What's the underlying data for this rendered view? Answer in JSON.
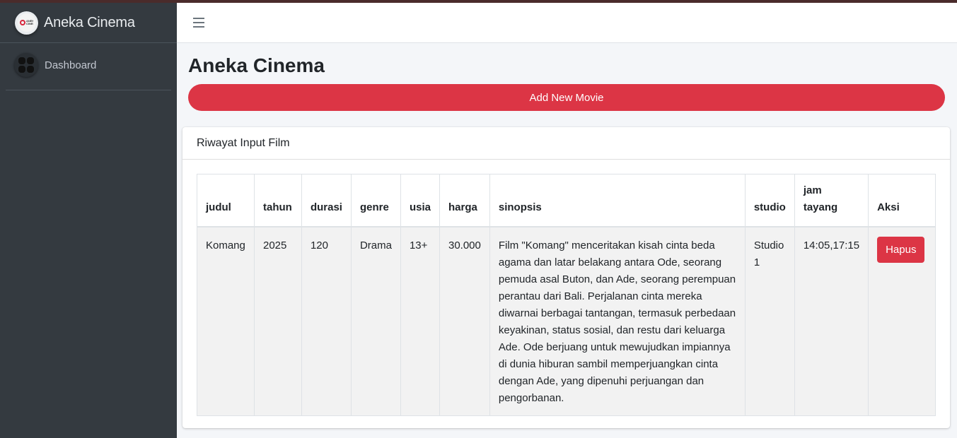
{
  "sidebar": {
    "brand_name": "Aneka Cinema",
    "logo_text": "ANEKA CINEMA",
    "items": [
      {
        "label": "Dashboard",
        "icon": "dashboard-grid-icon"
      }
    ]
  },
  "navbar": {
    "menu_icon": "hamburger-icon"
  },
  "page": {
    "title": "Aneka Cinema",
    "add_button": "Add New Movie"
  },
  "card": {
    "header": "Riwayat Input Film",
    "columns": [
      "judul",
      "tahun",
      "durasi",
      "genre",
      "usia",
      "harga",
      "sinopsis",
      "studio",
      "jam tayang",
      "Aksi"
    ],
    "rows": [
      {
        "judul": "Komang",
        "tahun": "2025",
        "durasi": "120",
        "genre": "Drama",
        "usia": "13+",
        "harga": "30.000",
        "sinopsis": "Film \"Komang\" menceritakan kisah cinta beda agama dan latar belakang antara Ode, seorang pemuda asal Buton, dan Ade, seorang perempuan perantau dari Bali. Perjalanan cinta mereka diwarnai berbagai tantangan, termasuk perbedaan keyakinan, status sosial, dan restu dari keluarga Ade. Ode berjuang untuk mewujudkan impiannya di dunia hiburan sambil memperjuangkan cinta dengan Ade, yang dipenuhi perjuangan dan pengorbanan.",
        "studio": "Studio 1",
        "jam_tayang": "14:05,17:15",
        "aksi": "Hapus"
      }
    ]
  },
  "colors": {
    "sidebar": "#343a40",
    "danger": "#dc3545",
    "background": "#f4f6f9"
  }
}
